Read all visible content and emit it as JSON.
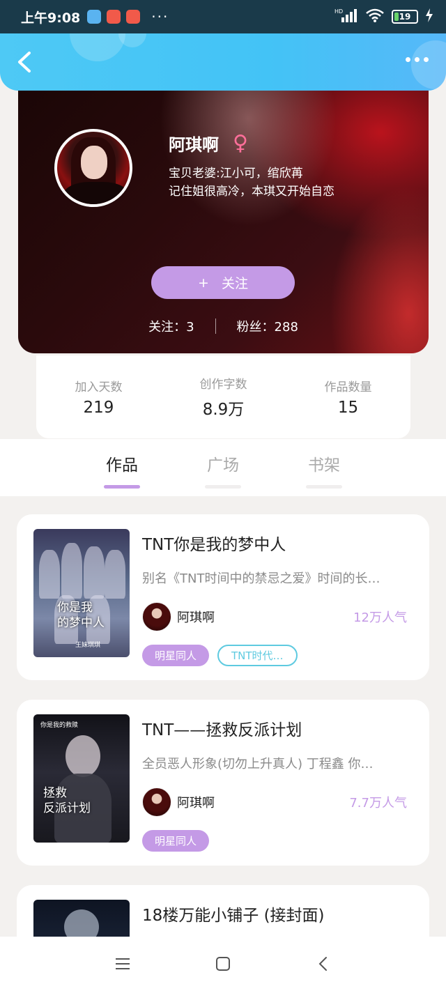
{
  "status_bar": {
    "time": "上午9:08",
    "more": "···",
    "network": "HD",
    "battery": "19"
  },
  "header": {
    "back_icon": "chevron-left-icon",
    "more_icon": "more-horizontal-icon"
  },
  "profile": {
    "name": "阿琪啊",
    "gender_symbol": "♀",
    "bio_line1": "宝贝老婆:江小可，绾欣苒",
    "bio_line2": "记住姐很高冷，本琪又开始自恋",
    "follow_button": "关注",
    "follow_plus": "+",
    "following": "关注：3",
    "fans": "粉丝：288"
  },
  "stats": [
    {
      "label": "加入天数",
      "value": "219"
    },
    {
      "label": "创作字数",
      "value": "8.9万"
    },
    {
      "label": "作品数量",
      "value": "15"
    }
  ],
  "tabs": [
    {
      "label": "作品",
      "active": true
    },
    {
      "label": "广场",
      "active": false
    },
    {
      "label": "书架",
      "active": false
    }
  ],
  "books": [
    {
      "title": "TNT你是我的梦中人",
      "desc": "别名《TNT时间中的禁忌之爱》时间的长…",
      "cover_text": "你是我\n的梦中人",
      "cover_small": "王妹琪琪",
      "author": "阿琪啊",
      "popularity": "12万人气",
      "tags": [
        "明星同人",
        "TNT时代…"
      ]
    },
    {
      "title": "TNT——拯救反派计划",
      "desc": "全员恶人形象(切勿上升真人) 丁程鑫 你…",
      "cover_text": "拯救\n反派计划",
      "cover_small": "你是我的救赎",
      "author": "阿琪啊",
      "popularity": "7.7万人气",
      "tags": [
        "明星同人"
      ]
    },
    {
      "title": "18楼万能小铺子 (接封面)"
    }
  ],
  "navbar": {
    "menu_icon": "menu-icon",
    "home_icon": "square-home-icon",
    "back_icon": "triangle-back-icon"
  },
  "colors": {
    "accent": "#c49ae6",
    "header_blue": "#4ec9f5",
    "tag_teal": "#5ecae0"
  }
}
